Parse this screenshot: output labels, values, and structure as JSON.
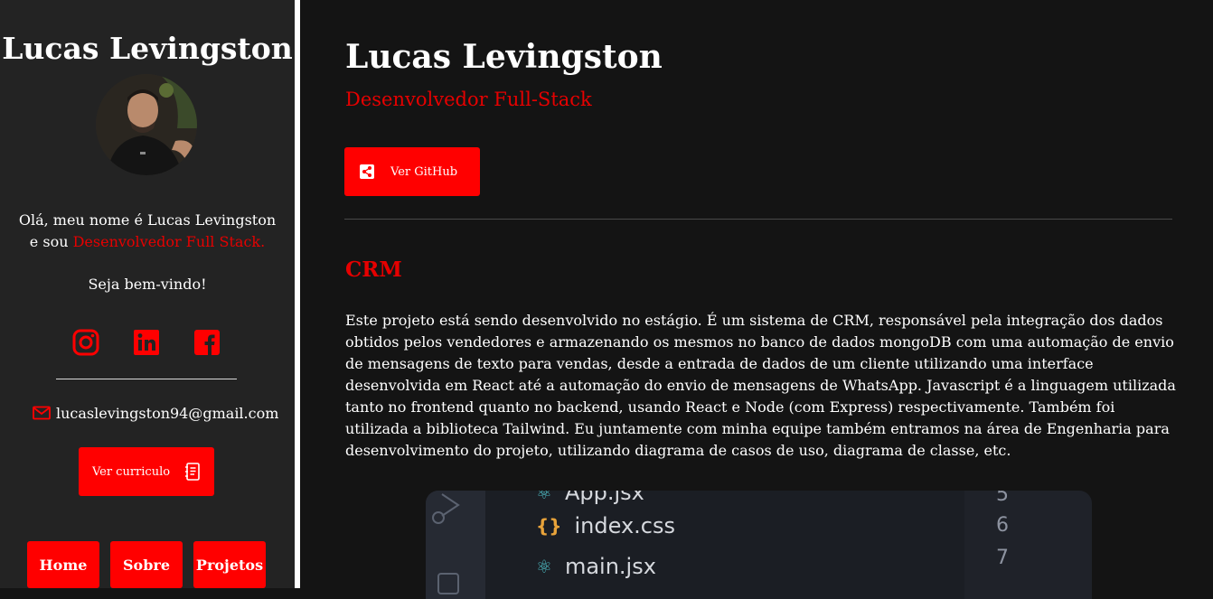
{
  "sidebar": {
    "name": "Lucas Levingston",
    "intro_line1": "Olá, meu nome é Lucas Levingston",
    "intro_line2_prefix": "e sou ",
    "intro_line2_accent": "Desenvolvedor Full Stack.",
    "welcome": "Seja bem-vindo!",
    "social_icons": [
      "instagram-icon",
      "linkedin-icon",
      "facebook-icon"
    ],
    "email": "lucaslevingston94@gmail.com",
    "cv_button": "Ver curriculo",
    "nav": {
      "home": "Home",
      "about": "Sobre",
      "projects": "Projetos"
    }
  },
  "main": {
    "title": "Lucas Levingston",
    "subtitle": "Desenvolvedor Full-Stack",
    "github_button": "Ver GitHub",
    "project": {
      "title": "CRM",
      "description": "Este projeto está sendo desenvolvido no estágio. É um sistema de CRM, responsável pela integração dos dados obtidos pelos vendedores e armazenando os mesmos no banco de dados mongoDB com uma automação de envio de mensagens de texto para vendas, desde a entrada de dados de um cliente utilizando uma interface desenvolvida em React até a automação do envio de mensagens de WhatsApp. Javascript é a linguagem utilizada tanto no frontend quanto no backend, usando React e Node (com Express) respectivamente. Também foi utilizada a biblioteca Tailwind. Eu juntamente com minha equipe também entramos na área de Engenharia para desenvolvimento do projeto, utilizando diagrama de casos de uso, diagrama de classe, etc."
    },
    "preview": {
      "files": [
        "App.jsx",
        "index.css",
        "main.jsx"
      ],
      "line_numbers": [
        "5",
        "6",
        "7"
      ]
    }
  },
  "colors": {
    "accent": "#ff0000",
    "accent_text": "#e60000",
    "sidebar_bg": "#232323",
    "main_bg": "#141414"
  }
}
